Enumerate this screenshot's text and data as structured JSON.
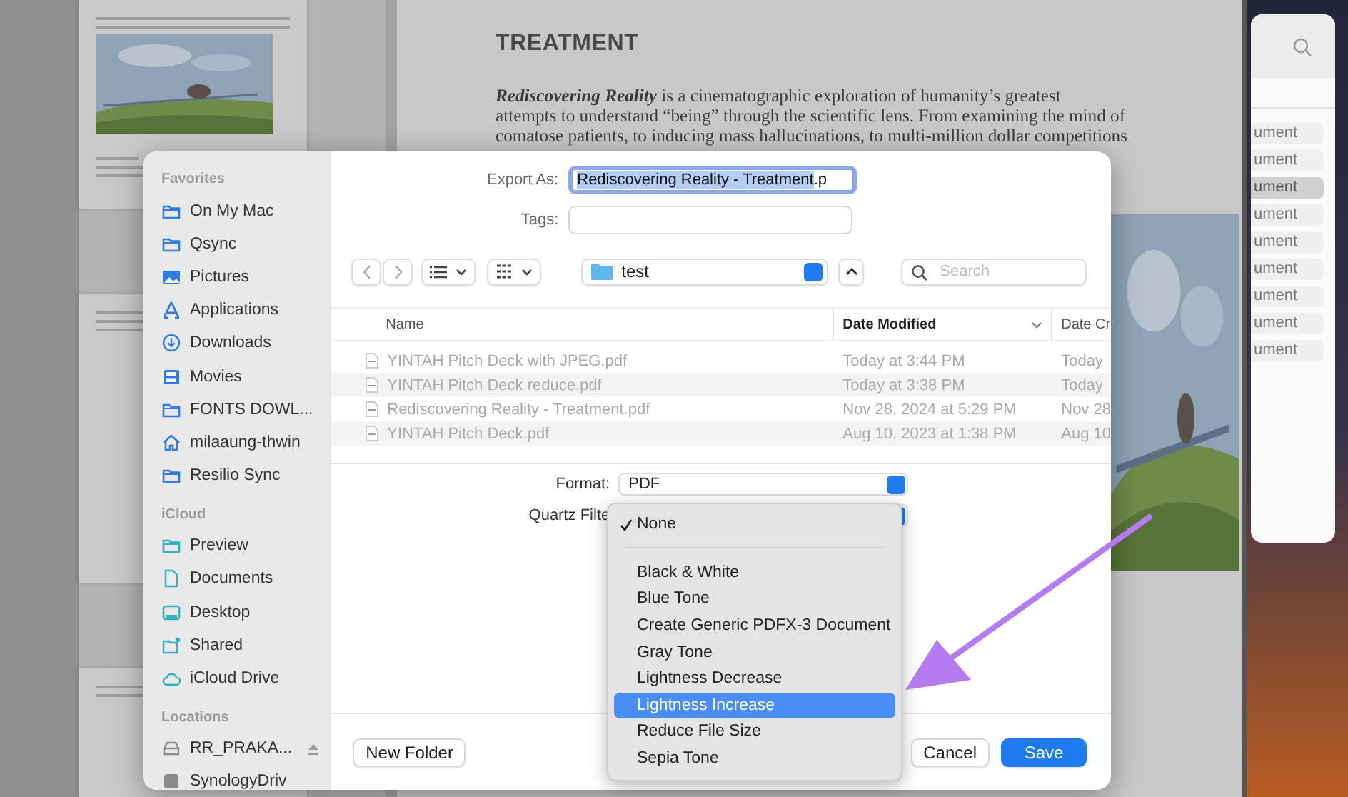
{
  "document": {
    "heading": "TREATMENT",
    "lines": [
      "**Rediscovering Reality** is a cinematographic exploration of humanity’s greatest",
      "attempts to understand “being” through the scientific lens. From examining the mind of",
      "comatose patients, to inducing mass hallucinations, to multi-million dollar competitions"
    ]
  },
  "side_panel": {
    "items": [
      {
        "label": "ument",
        "selected": false
      },
      {
        "label": "ument",
        "selected": false
      },
      {
        "label": "ument",
        "selected": true
      },
      {
        "label": "ument",
        "selected": false
      },
      {
        "label": "ument",
        "selected": false
      },
      {
        "label": "ument",
        "selected": false
      },
      {
        "label": "ument",
        "selected": false
      },
      {
        "label": "ument",
        "selected": false
      },
      {
        "label": "ument",
        "selected": false
      }
    ]
  },
  "dialog": {
    "sidebar": [
      {
        "title": "Favorites",
        "items": [
          {
            "label": "On My Mac",
            "kind": "folder"
          },
          {
            "label": "Qsync",
            "kind": "folder"
          },
          {
            "label": "Pictures",
            "kind": "pictures"
          },
          {
            "label": "Applications",
            "kind": "apps"
          },
          {
            "label": "Downloads",
            "kind": "downloads"
          },
          {
            "label": "Movies",
            "kind": "movies"
          },
          {
            "label": "FONTS DOWL...",
            "kind": "folder"
          },
          {
            "label": "milaaung-thwin",
            "kind": "home"
          },
          {
            "label": "Resilio Sync",
            "kind": "folder"
          }
        ]
      },
      {
        "title": "iCloud",
        "items": [
          {
            "label": "Preview",
            "kind": "folder"
          },
          {
            "label": "Documents",
            "kind": "document"
          },
          {
            "label": "Desktop",
            "kind": "desktop"
          },
          {
            "label": "Shared",
            "kind": "shared"
          },
          {
            "label": "iCloud Drive",
            "kind": "cloud"
          }
        ]
      },
      {
        "title": "Locations",
        "items": [
          {
            "label": "RR_PRAKA...",
            "kind": "drive"
          },
          {
            "label": "SynologyDriv",
            "kind": "sync"
          }
        ]
      }
    ],
    "export_as": {
      "label": "Export As:",
      "value_selected": "Rediscovering Reality - Treatment",
      "value_rest": ".p"
    },
    "tags": {
      "label": "Tags:"
    },
    "location": "test",
    "search": {
      "placeholder": "Search"
    },
    "table": {
      "columns": [
        {
          "label": "Name",
          "sorted": false
        },
        {
          "label": "Date Modified",
          "sorted": true
        },
        {
          "label": "Date Cr",
          "sorted": false
        }
      ],
      "rows": [
        {
          "name": "YINTAH Pitch Deck with JPEG.pdf",
          "modified": "Today at 3:44 PM",
          "created": "Today",
          "disabled": true
        },
        {
          "name": "YINTAH Pitch Deck reduce.pdf",
          "modified": "Today at 3:38 PM",
          "created": "Today",
          "disabled": true
        },
        {
          "name": "Rediscovering Reality - Treatment.pdf",
          "modified": "Nov 28, 2024 at 5:29 PM",
          "created": "Nov 28",
          "disabled": true
        },
        {
          "name": "YINTAH Pitch Deck.pdf",
          "modified": "Aug 10, 2023 at 1:38 PM",
          "created": "Aug 10",
          "disabled": true
        }
      ]
    },
    "format": {
      "label": "Format:",
      "value": "PDF"
    },
    "quartz_filter": {
      "label": "Quartz Filte"
    },
    "menu": [
      {
        "kind": "item",
        "label": "None",
        "checked": true,
        "selected": false
      },
      {
        "kind": "separator"
      },
      {
        "kind": "item",
        "label": "Black & White",
        "checked": false,
        "selected": false
      },
      {
        "kind": "item",
        "label": "Blue Tone",
        "checked": false,
        "selected": false
      },
      {
        "kind": "item",
        "label": "Create Generic PDFX-3 Document",
        "checked": false,
        "selected": false
      },
      {
        "kind": "item",
        "label": "Gray Tone",
        "checked": false,
        "selected": false
      },
      {
        "kind": "item",
        "label": "Lightness Decrease",
        "checked": false,
        "selected": false
      },
      {
        "kind": "item",
        "label": "Lightness Increase",
        "checked": false,
        "selected": true
      },
      {
        "kind": "item",
        "label": "Reduce File Size",
        "checked": false,
        "selected": false
      },
      {
        "kind": "item",
        "label": "Sepia Tone",
        "checked": false,
        "selected": false
      }
    ],
    "buttons": {
      "new_folder": "New Folder",
      "cancel": "Cancel",
      "save": "Save"
    }
  }
}
